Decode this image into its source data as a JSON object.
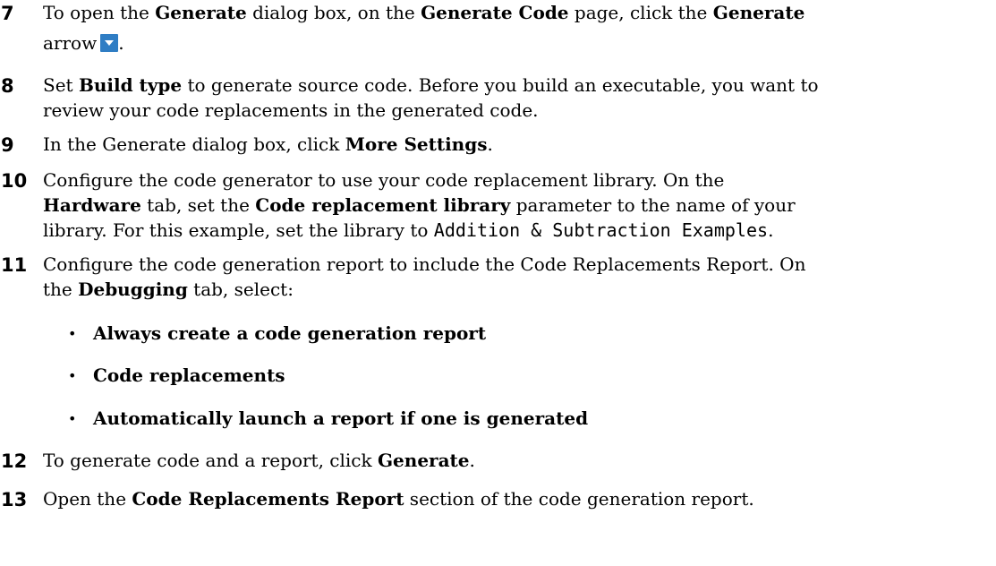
{
  "steps": [
    {
      "num": "7",
      "line1": {
        "t1": "To open the ",
        "b1": "Generate",
        "t2": " dialog box, on the ",
        "b2": "Generate Code",
        "t3": " page, click the ",
        "b3": "Generate"
      },
      "line2": {
        "t1": "arrow",
        "end": "."
      }
    },
    {
      "num": "8",
      "line1": {
        "t1": "Set ",
        "b1": "Build type",
        "t2": " to generate source code. Before you build an executable, you want to"
      },
      "line2": {
        "t1": "review your code replacements in the generated code."
      }
    },
    {
      "num": "9",
      "line1": {
        "t1": "In the Generate dialog box, click ",
        "b1": "More Settings",
        "end": "."
      }
    },
    {
      "num": "10",
      "line1": {
        "t1": "Configure the code generator to use your code replacement library. On the"
      },
      "line2": {
        "b1": "Hardware",
        "t1": " tab, set the ",
        "b2": "Code replacement library",
        "t2": " parameter to the name of your"
      },
      "line3": {
        "t1": "library. For this example, set the library to ",
        "code": "Addition & Subtraction Examples",
        "end": "."
      }
    },
    {
      "num": "11",
      "line1": {
        "t1": "Configure the code generation report to include the Code Replacements Report. On"
      },
      "line2": {
        "t1": "the ",
        "b1": "Debugging",
        "t2": " tab, select:"
      },
      "bullets": [
        "Always create a code generation report",
        "Code replacements",
        "Automatically launch a report if one is generated"
      ]
    },
    {
      "num": "12",
      "line1": {
        "t1": "To generate code and a report, click ",
        "b1": "Generate",
        "end": "."
      }
    },
    {
      "num": "13",
      "line1": {
        "t1": "Open the ",
        "b1": "Code Replacements Report",
        "t2": " section of the code generation report."
      }
    }
  ],
  "icons": {
    "generate_arrow": "dropdown-arrow-icon",
    "generate_arrow_color": "#2f7dc4"
  }
}
